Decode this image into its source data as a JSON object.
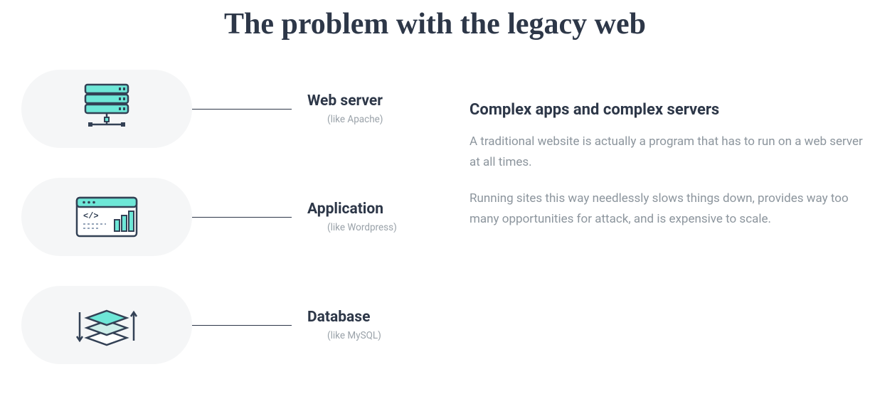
{
  "title": "The problem with the legacy web",
  "items": [
    {
      "label": "Web server",
      "sublabel": "(like Apache)"
    },
    {
      "label": "Application",
      "sublabel": "(like Wordpress)"
    },
    {
      "label": "Database",
      "sublabel": "(like MySQL)"
    }
  ],
  "explainer": {
    "heading": "Complex apps and complex servers",
    "p1": "A traditional website is actually a program that has to run on a web server at all times.",
    "p2": "Running sites this way needlessly slows things down, provides way too many opportunities for attack, and is expensive to scale."
  }
}
